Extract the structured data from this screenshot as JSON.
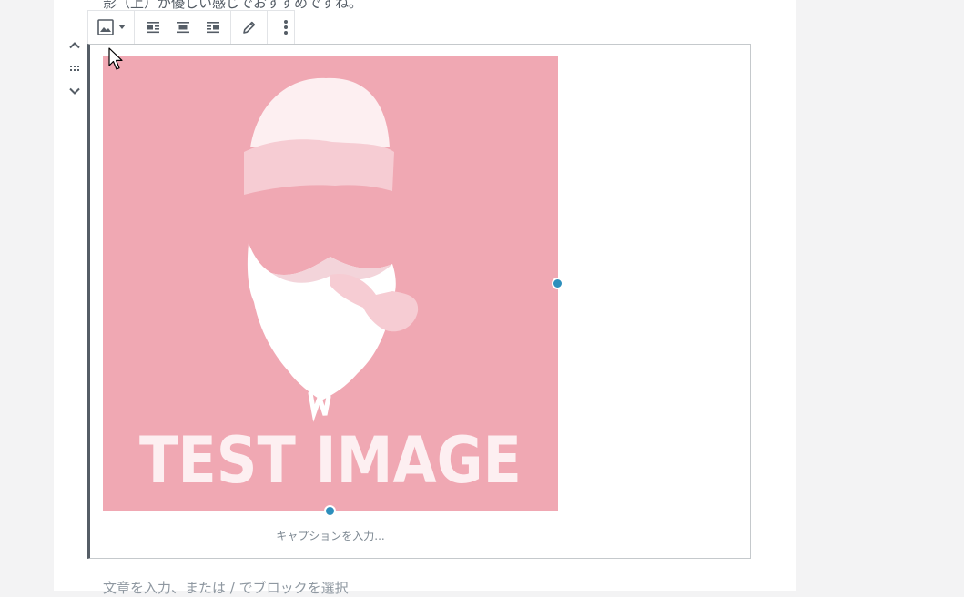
{
  "editor": {
    "previous_paragraph": "影（上）が優しい感じでおすすめですね。",
    "next_paragraph_placeholder": "文章を入力、または / でブロックを選択"
  },
  "block_mover": {
    "up_icon": "chevron-up-icon",
    "drag_icon": "drag-handle-icon",
    "down_icon": "chevron-down-icon"
  },
  "toolbar": {
    "block_type_icon": "image-icon",
    "dropdown_icon": "caret-down-icon",
    "align_left_icon": "align-left-icon",
    "align_center_icon": "align-center-icon",
    "align_right_icon": "align-right-icon",
    "edit_icon": "pencil-icon",
    "more_icon": "more-vertical-icon"
  },
  "image_block": {
    "image_text": "TEST IMAGE",
    "caption_placeholder": "キャプションを入力...",
    "colors": {
      "background": "#f0a8b3",
      "hat": "#fdeff1",
      "hat_brim": "#f6ccd3",
      "beard": "#ffffff",
      "pipe": "#f6ccd3",
      "text": "#fdeff1",
      "handle": "#2d8fbc"
    }
  }
}
